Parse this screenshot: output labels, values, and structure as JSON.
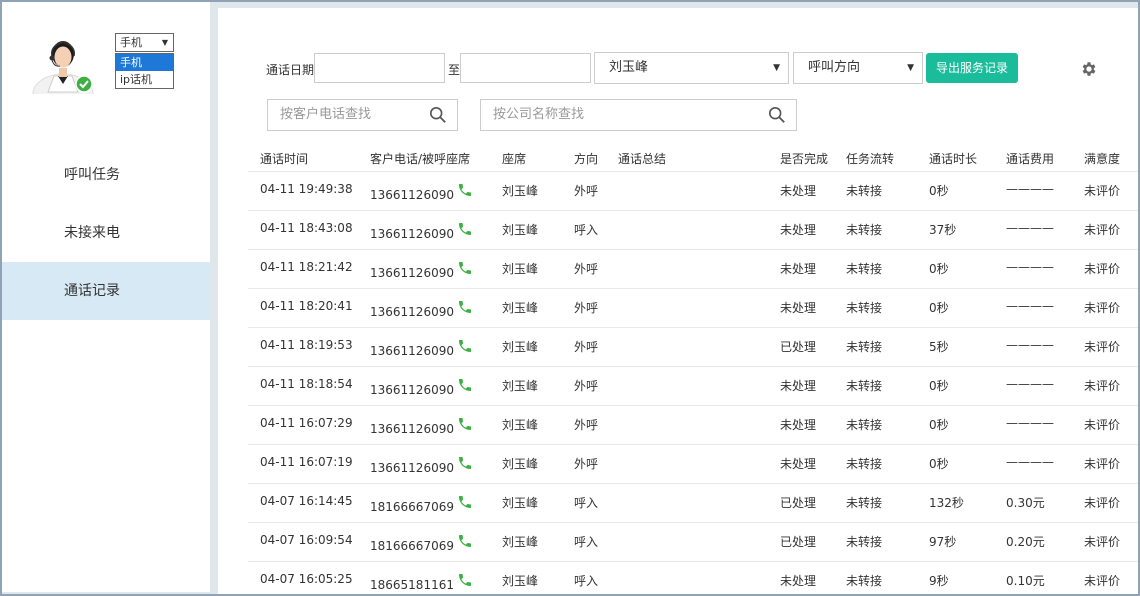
{
  "device": {
    "selected": "手机",
    "options": [
      "手机",
      "ip话机"
    ]
  },
  "nav": {
    "items": [
      "呼叫任务",
      "未接来电",
      "通话记录"
    ],
    "active_index": 2
  },
  "filters": {
    "date_label": "通话日期",
    "to_label": "至",
    "date_from": "",
    "date_to": "",
    "agent_value": "刘玉峰",
    "direction_value": "呼叫方向",
    "export_label": "导出服务记录",
    "search_phone_placeholder": "按客户电话查找",
    "search_company_placeholder": "按公司名称查找"
  },
  "table": {
    "headers": [
      "通话时间",
      "客户电话/被呼座席",
      "座席",
      "方向",
      "通话总结",
      "是否完成",
      "任务流转",
      "通话时长",
      "通话费用",
      "满意度"
    ],
    "rows": [
      {
        "time": "04-11 19:49:38",
        "phone": "13661126090",
        "agent": "刘玉峰",
        "dir": "外呼",
        "summary": "",
        "done": "未处理",
        "flow": "未转接",
        "dur": "0秒",
        "fee": "————",
        "sat": "未评价"
      },
      {
        "time": "04-11 18:43:08",
        "phone": "13661126090",
        "agent": "刘玉峰",
        "dir": "呼入",
        "summary": "",
        "done": "未处理",
        "flow": "未转接",
        "dur": "37秒",
        "fee": "————",
        "sat": "未评价"
      },
      {
        "time": "04-11 18:21:42",
        "phone": "13661126090",
        "agent": "刘玉峰",
        "dir": "外呼",
        "summary": "",
        "done": "未处理",
        "flow": "未转接",
        "dur": "0秒",
        "fee": "————",
        "sat": "未评价"
      },
      {
        "time": "04-11 18:20:41",
        "phone": "13661126090",
        "agent": "刘玉峰",
        "dir": "外呼",
        "summary": "",
        "done": "未处理",
        "flow": "未转接",
        "dur": "0秒",
        "fee": "————",
        "sat": "未评价"
      },
      {
        "time": "04-11 18:19:53",
        "phone": "13661126090",
        "agent": "刘玉峰",
        "dir": "外呼",
        "summary": "",
        "done": "已处理",
        "flow": "未转接",
        "dur": "5秒",
        "fee": "————",
        "sat": "未评价"
      },
      {
        "time": "04-11 18:18:54",
        "phone": "13661126090",
        "agent": "刘玉峰",
        "dir": "外呼",
        "summary": "",
        "done": "未处理",
        "flow": "未转接",
        "dur": "0秒",
        "fee": "————",
        "sat": "未评价"
      },
      {
        "time": "04-11 16:07:29",
        "phone": "13661126090",
        "agent": "刘玉峰",
        "dir": "外呼",
        "summary": "",
        "done": "未处理",
        "flow": "未转接",
        "dur": "0秒",
        "fee": "————",
        "sat": "未评价"
      },
      {
        "time": "04-11 16:07:19",
        "phone": "13661126090",
        "agent": "刘玉峰",
        "dir": "外呼",
        "summary": "",
        "done": "未处理",
        "flow": "未转接",
        "dur": "0秒",
        "fee": "————",
        "sat": "未评价"
      },
      {
        "time": "04-07 16:14:45",
        "phone": "18166667069",
        "agent": "刘玉峰",
        "dir": "呼入",
        "summary": "",
        "done": "已处理",
        "flow": "未转接",
        "dur": "132秒",
        "fee": "0.30元",
        "sat": "未评价"
      },
      {
        "time": "04-07 16:09:54",
        "phone": "18166667069",
        "agent": "刘玉峰",
        "dir": "呼入",
        "summary": "",
        "done": "已处理",
        "flow": "未转接",
        "dur": "97秒",
        "fee": "0.20元",
        "sat": "未评价"
      },
      {
        "time": "04-07 16:05:25",
        "phone": "18665181161",
        "agent": "刘玉峰",
        "dir": "呼入",
        "summary": "",
        "done": "未处理",
        "flow": "未转接",
        "dur": "9秒",
        "fee": "0.10元",
        "sat": "未评价"
      }
    ]
  },
  "colors": {
    "accent": "#1bbc9b",
    "active_nav": "#d7e9f5",
    "phone_icon": "#3cb043"
  },
  "icons": {
    "call": "phone-icon",
    "settings": "gear-icon",
    "search": "search-icon"
  }
}
